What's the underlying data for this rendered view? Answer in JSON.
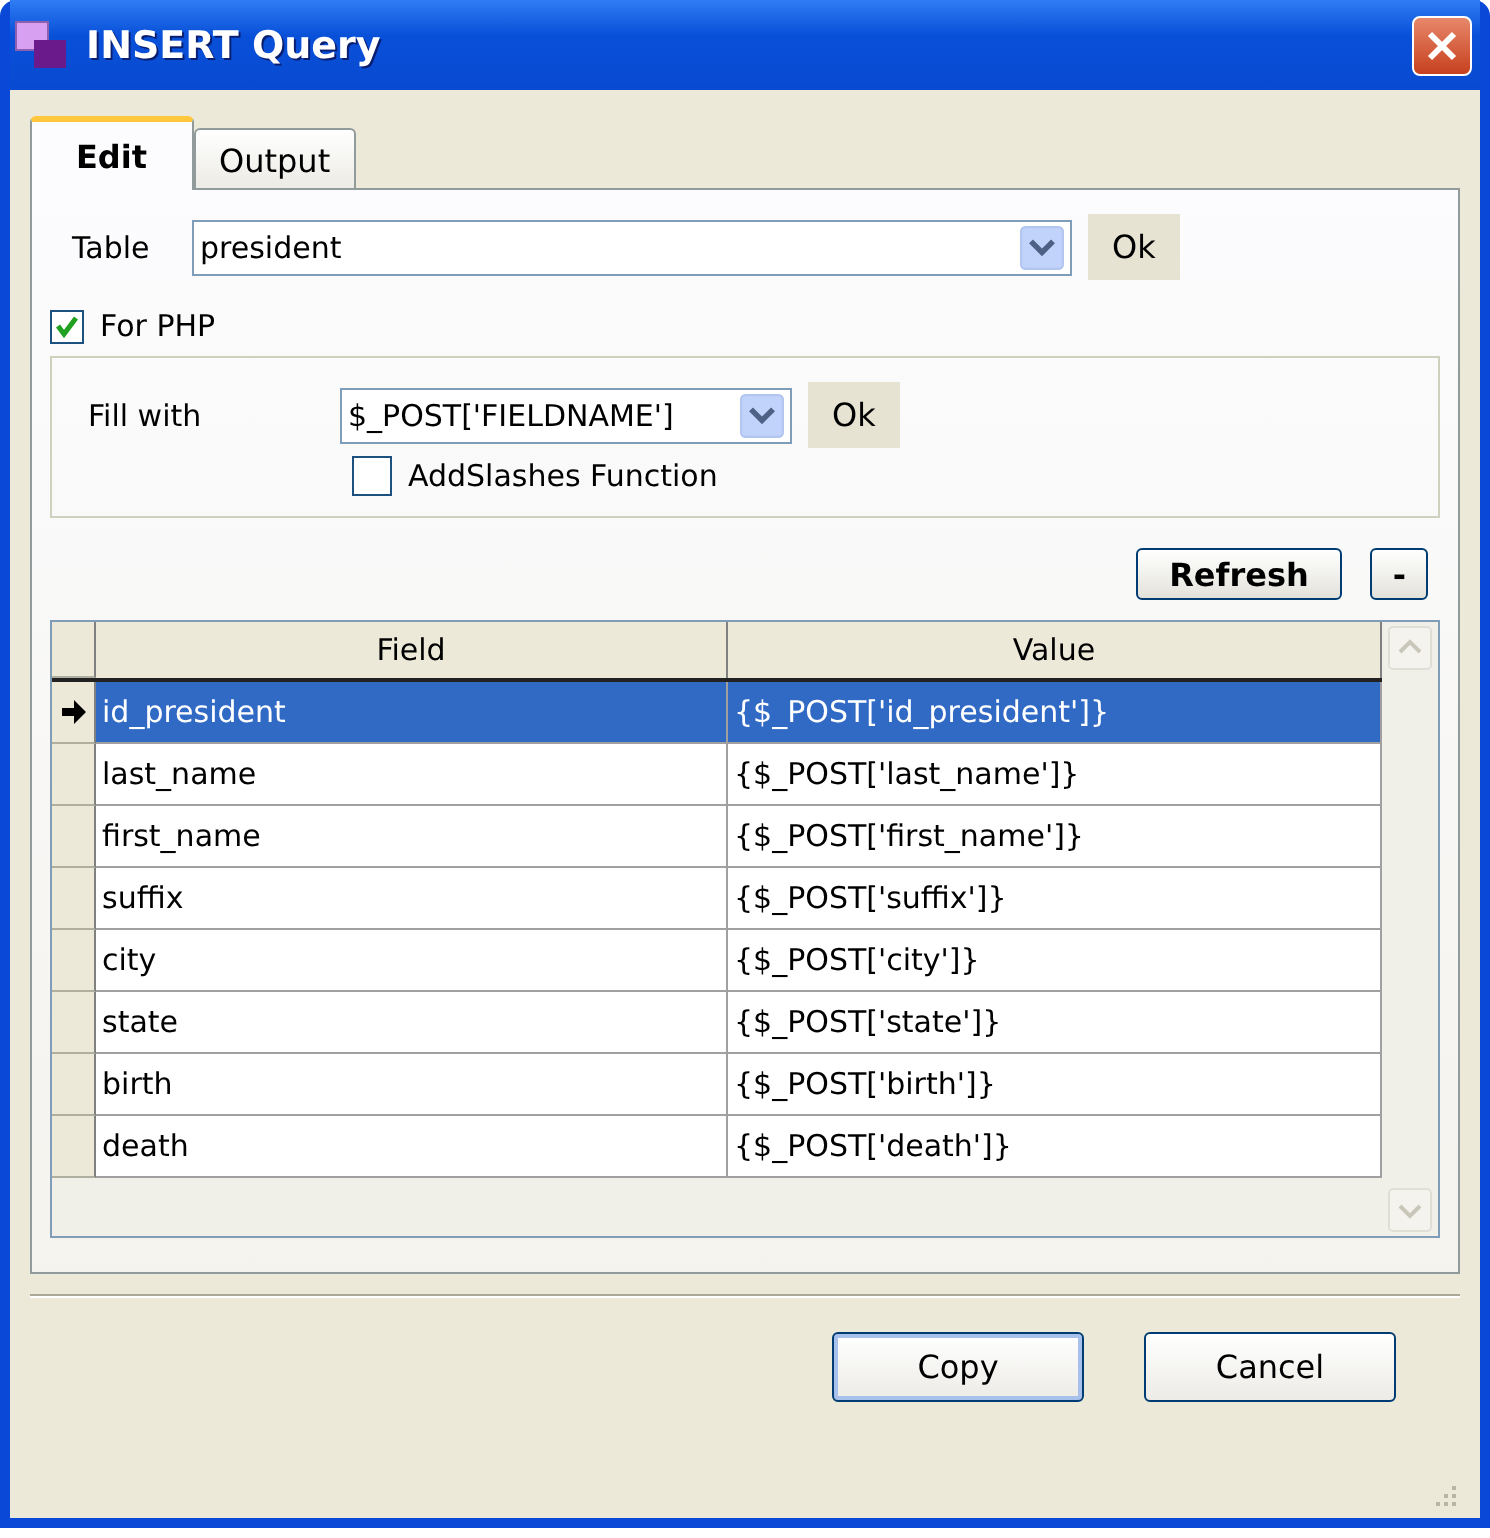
{
  "window": {
    "title": "INSERT Query"
  },
  "tabs": [
    {
      "label": "Edit",
      "selected": true
    },
    {
      "label": "Output",
      "selected": false
    }
  ],
  "table_field": {
    "label": "Table",
    "value": "president",
    "button": "Ok"
  },
  "for_php": {
    "label": "For PHP",
    "checked": true
  },
  "fill_with": {
    "label": "Fill with",
    "value": "$_POST['FIELDNAME']",
    "button": "Ok"
  },
  "addslashes": {
    "label": "AddSlashes Function",
    "checked": false
  },
  "grid_buttons": [
    "Refresh",
    "-"
  ],
  "grid": {
    "columns": [
      "Field",
      "Value"
    ],
    "rows": [
      {
        "field": "id_president",
        "value": "{$_POST['id_president']}",
        "selected": true
      },
      {
        "field": "last_name",
        "value": "{$_POST['last_name']}",
        "selected": false
      },
      {
        "field": "first_name",
        "value": "{$_POST['first_name']}",
        "selected": false
      },
      {
        "field": "suffix",
        "value": "{$_POST['suffix']}",
        "selected": false
      },
      {
        "field": "city",
        "value": "{$_POST['city']}",
        "selected": false
      },
      {
        "field": "state",
        "value": "{$_POST['state']}",
        "selected": false
      },
      {
        "field": "birth",
        "value": "{$_POST['birth']}",
        "selected": false
      },
      {
        "field": "death",
        "value": "{$_POST['death']}",
        "selected": false
      }
    ]
  },
  "buttons": [
    "Copy",
    "Cancel"
  ]
}
